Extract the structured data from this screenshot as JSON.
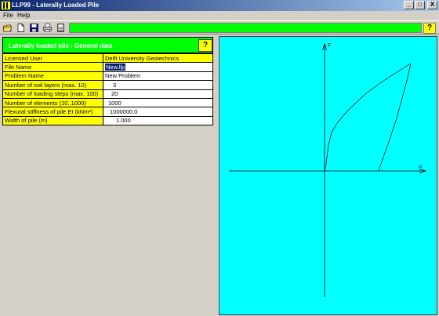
{
  "window": {
    "title": "LLP99 - Laterally Loaded Pile",
    "min_label": "_",
    "max_label": "□",
    "close_label": "X"
  },
  "menu": {
    "file": "File",
    "help": "Help"
  },
  "toolbar": {
    "buttons": [
      "open-folder-icon",
      "new-document-icon",
      "save-disk-icon",
      "print-icon",
      "calculator-icon"
    ],
    "help_label": "?"
  },
  "panel": {
    "title": "Laterally loaded pile : General data",
    "help_label": "?",
    "rows": [
      {
        "label": "Licensed User",
        "value": "Delft University Geotechnics"
      },
      {
        "label": "File Name",
        "value": "New.llp"
      },
      {
        "label": "Problem Name",
        "value": "New Problem"
      },
      {
        "label": "Number of soil layers (max. 10)",
        "value": "3"
      },
      {
        "label": "Number of loading steps (max. 100)",
        "value": "20"
      },
      {
        "label": "Number of elements (10..1000)",
        "value": "1000"
      },
      {
        "label": "Flexural stiffness of pile EI (kNm²)",
        "value": "1000000.0"
      },
      {
        "label": "Width of pile (m)",
        "value": "1.000"
      }
    ]
  },
  "plot": {
    "y_axis_label": "F",
    "x_axis_label": "u"
  },
  "colors": {
    "accent_green": "#00ff00",
    "label_yellow": "#ffff00",
    "plot_cyan": "#00ffff"
  }
}
